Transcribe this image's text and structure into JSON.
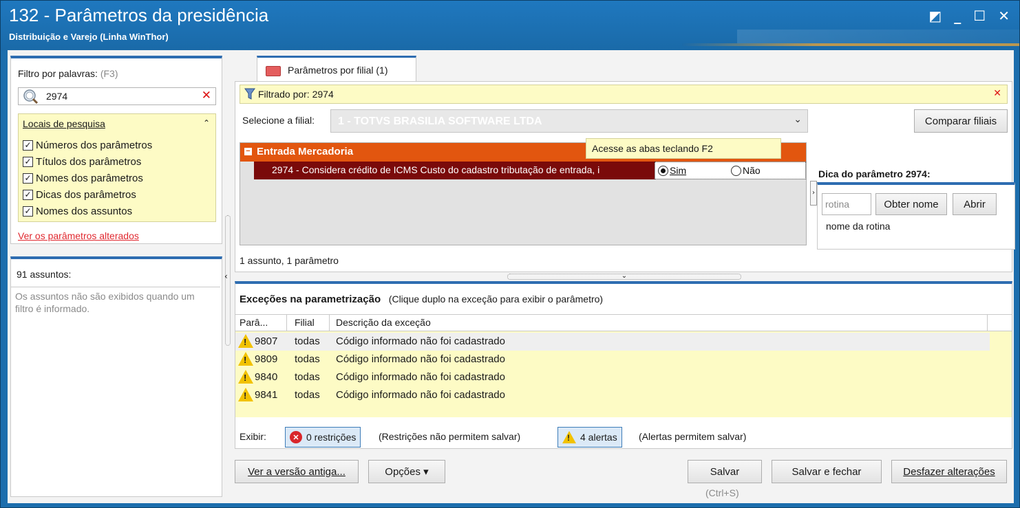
{
  "window": {
    "title": "132 - Parâmetros da presidência",
    "subtitle": "Distribuição e Varejo (Linha WinThor)",
    "controls": [
      "◩",
      "_",
      "☐",
      "✕"
    ]
  },
  "filter": {
    "label": "Filtro por palavras:",
    "shortcut": "(F3)",
    "value": "2974",
    "clear": "✕"
  },
  "locais": {
    "title": "Locais de pesquisa",
    "collapse": "⌃",
    "items": [
      {
        "label": "Números dos parâmetros",
        "checked": true
      },
      {
        "label": "Títulos dos parâmetros",
        "checked": true
      },
      {
        "label": "Nomes dos parâmetros",
        "checked": true
      },
      {
        "label": "Dicas dos parâmetros",
        "checked": true
      },
      {
        "label": "Nomes dos assuntos",
        "checked": true
      }
    ],
    "check_glyph": "✓"
  },
  "changed_link": "Ver os parâmetros alterados",
  "assuntos": {
    "count_label": "91 assuntos:",
    "empty_msg": "Os assuntos não são exibidos quando um filtro é informado."
  },
  "tab": {
    "label": "Parâmetros por filial",
    "count": "(1)"
  },
  "filtered": {
    "label": "Filtrado por: 2974",
    "clear": "✕"
  },
  "branch": {
    "label": "Selecione a filial:",
    "value": "1 - TOTVS BRASILIA SOFTWARE LTDA",
    "arrow": "⌄",
    "compare_button": "Comparar filiais"
  },
  "grid": {
    "group": "Entrada Mercadoria",
    "param_text": "2974 - Considera crédito de ICMS Custo do cadastro tributação de entrada, i",
    "option_yes": "Sim",
    "option_no": "Não",
    "selected": "Sim",
    "count": "1 assunto, 1 parâmetro"
  },
  "hint": {
    "info": "Acesse as abas teclando F2",
    "title": "Dica do parâmetro 2974:",
    "rotina_placeholder": "rotina",
    "obter_button": "Obter nome",
    "abrir_button": "Abrir",
    "nome": "nome da rotina"
  },
  "exceptions": {
    "title": "Exceções na parametrização",
    "subtitle": "(Clique duplo na exceção para exibir o parâmetro)",
    "columns": [
      "Parâ...",
      "Filial",
      "Descrição da exceção"
    ],
    "rows": [
      {
        "param": "9807",
        "filial": "todas",
        "desc": "Código informado não foi cadastrado"
      },
      {
        "param": "9809",
        "filial": "todas",
        "desc": "Código informado não foi cadastrado"
      },
      {
        "param": "9840",
        "filial": "todas",
        "desc": "Código informado não foi cadastrado"
      },
      {
        "param": "9841",
        "filial": "todas",
        "desc": "Código informado não foi cadastrado"
      }
    ],
    "exibir": "Exibir:",
    "restricoes": "0 restrições",
    "restricoes_note": "(Restrições não permitem salvar)",
    "alertas": "4 alertas",
    "alertas_note": "(Alertas permitem salvar)"
  },
  "footer": {
    "old_version": "Ver a versão antiga...",
    "options": "Opções ▾",
    "save": "Salvar",
    "save_shortcut": "(Ctrl+S)",
    "save_close": "Salvar e fechar",
    "undo": "Desfazer alterações"
  },
  "colors": {
    "accent": "#2e6db1",
    "group_header": "#e2560f",
    "selected_row": "#7a0a0a",
    "hint_bg": "#fdfbc5",
    "titlebar": "#1c6ead"
  }
}
